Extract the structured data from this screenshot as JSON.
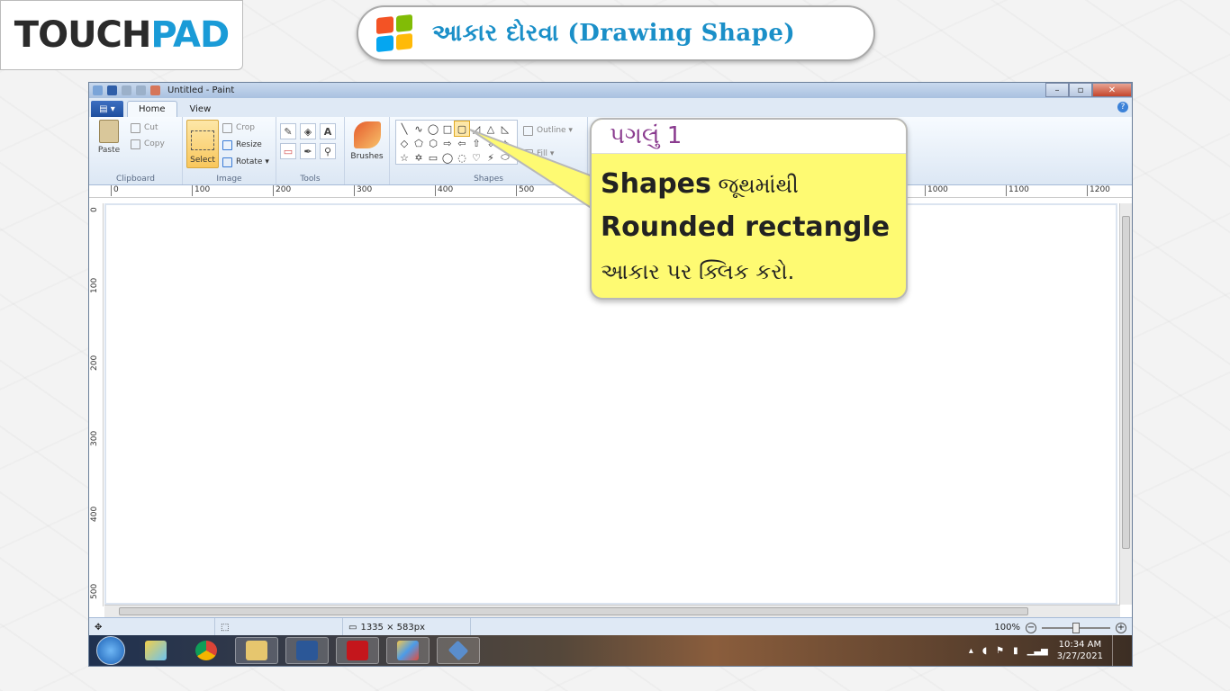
{
  "branding": {
    "logo_touch": "TOUCH",
    "logo_pad": "PAD"
  },
  "title_banner": {
    "text": "આકાર દોરવા (Drawing Shape)",
    "colors": [
      "#f35325",
      "#81bc06",
      "#05a6f0",
      "#ffba08"
    ]
  },
  "window": {
    "title": "Untitled - Paint",
    "buttons": [
      "–",
      "▫",
      "✕"
    ]
  },
  "tabs": {
    "file": "▤ ▾",
    "home": "Home",
    "view": "View",
    "help": "?"
  },
  "ribbon": {
    "clipboard": {
      "label": "Clipboard",
      "paste": "Paste",
      "cut": "Cut",
      "copy": "Copy"
    },
    "image": {
      "label": "Image",
      "select": "Select",
      "crop": "Crop",
      "resize": "Resize",
      "rotate": "Rotate ▾"
    },
    "tools": {
      "label": "Tools",
      "icons": [
        "✎",
        "◈",
        "A",
        "▭",
        "✒",
        "⚲"
      ]
    },
    "brushes": {
      "label": "Brushes"
    },
    "shapes": {
      "label": "Shapes",
      "glyphs": [
        "╲",
        "∿",
        "◯",
        "□",
        "▢",
        "◿",
        "△",
        "◺",
        "◇",
        "⬠",
        "⬡",
        "⇨",
        "⇦",
        "⇧",
        "⇩",
        "✧",
        "☆",
        "✡",
        "▭",
        "◯",
        "◌",
        "♡",
        "⚡",
        "⬭"
      ],
      "outline": "Outline ▾",
      "fill": "Fill ▾"
    }
  },
  "ruler_h": [
    "0",
    "100",
    "200",
    "300",
    "400",
    "500",
    "1000",
    "1100",
    "1200"
  ],
  "ruler_v": [
    "0",
    "100",
    "200",
    "300",
    "400",
    "500"
  ],
  "status": {
    "size": "1335 × 583px",
    "zoom": "100%"
  },
  "taskbar": {
    "time": "10:34 AM",
    "date": "3/27/2021"
  },
  "callout": {
    "step": "પગલું 1",
    "line1_bold": "Shapes",
    "line1_rest": " જૂથમાંથી",
    "line2": "Rounded rectangle",
    "line3": "આકાર પર ક્લિક કરો."
  }
}
